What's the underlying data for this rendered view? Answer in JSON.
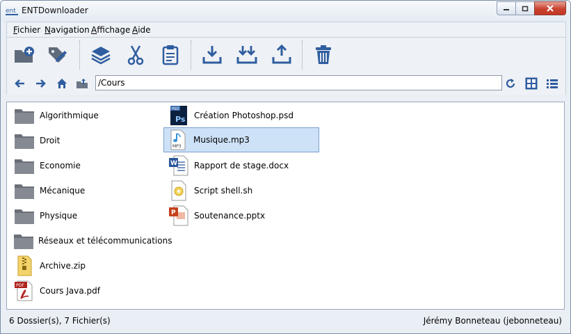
{
  "window": {
    "title": "ENTDownloader"
  },
  "menubar": {
    "items": [
      {
        "label": "Fichier",
        "accel": "F",
        "rest": "ichier"
      },
      {
        "label": "Navigation",
        "accel": "N",
        "rest": "avigation"
      },
      {
        "label": "Affichage",
        "accel": "A",
        "rest": "ffichage"
      },
      {
        "label": "Aide",
        "accel": "A",
        "rest": "ide"
      }
    ]
  },
  "toolbar": {
    "buttons": [
      {
        "name": "new-folder",
        "icon": "folder-plus-icon"
      },
      {
        "name": "rename",
        "icon": "tag-edit-icon"
      },
      {
        "name": "select-all",
        "icon": "layers-icon"
      },
      {
        "name": "cut",
        "icon": "scissors-icon"
      },
      {
        "name": "paste",
        "icon": "clipboard-icon"
      },
      {
        "name": "download",
        "icon": "download-icon"
      },
      {
        "name": "download-all",
        "icon": "double-download-icon"
      },
      {
        "name": "upload",
        "icon": "upload-icon"
      },
      {
        "name": "delete",
        "icon": "trash-icon"
      }
    ],
    "accent": "#2f5d9f"
  },
  "navbar": {
    "path": "/Cours"
  },
  "files": {
    "column1": [
      {
        "name": "Algorithmique",
        "type": "folder"
      },
      {
        "name": "Droit",
        "type": "folder"
      },
      {
        "name": "Economie",
        "type": "folder"
      },
      {
        "name": "Mécanique",
        "type": "folder"
      },
      {
        "name": "Physique",
        "type": "folder"
      },
      {
        "name": "Réseaux et télécommunications",
        "type": "folder"
      },
      {
        "name": "Archive.zip",
        "type": "zip"
      },
      {
        "name": "Cours Java.pdf",
        "type": "pdf"
      }
    ],
    "column2": [
      {
        "name": "Création Photoshop.psd",
        "type": "psd"
      },
      {
        "name": "Musique.mp3",
        "type": "mp3",
        "selected": true
      },
      {
        "name": "Rapport de stage.docx",
        "type": "docx"
      },
      {
        "name": "Script shell.sh",
        "type": "sh"
      },
      {
        "name": "Soutenance.pptx",
        "type": "pptx"
      }
    ]
  },
  "status": {
    "summary": "6 Dossier(s), 7 Fichier(s)",
    "user": "Jérémy Bonneteau (jebonneteau)"
  }
}
